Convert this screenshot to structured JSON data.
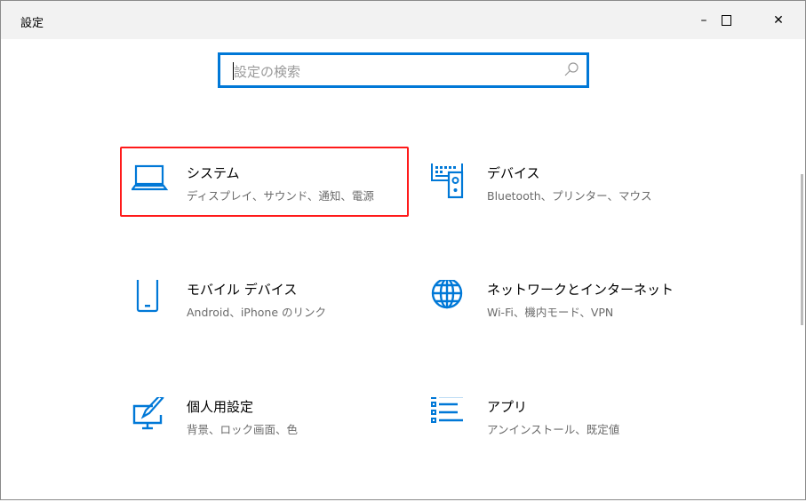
{
  "window": {
    "title": "設定",
    "minimize": "–",
    "maximize": "☐",
    "close": "✕"
  },
  "search": {
    "placeholder": "設定の検索"
  },
  "colors": {
    "accent": "#0078d7",
    "highlight": "#ff1a1a"
  },
  "tiles": [
    {
      "title": "システム",
      "subtitle": "ディスプレイ、サウンド、通知、電源",
      "icon": "laptop-icon"
    },
    {
      "title": "デバイス",
      "subtitle": "Bluetooth、プリンター、マウス",
      "icon": "keyboard-speaker-icon"
    },
    {
      "title": "モバイル デバイス",
      "subtitle": "Android、iPhone のリンク",
      "icon": "phone-icon"
    },
    {
      "title": "ネットワークとインターネット",
      "subtitle": "Wi-Fi、機内モード、VPN",
      "icon": "globe-icon"
    },
    {
      "title": "個人用設定",
      "subtitle": "背景、ロック画面、色",
      "icon": "personalization-icon"
    },
    {
      "title": "アプリ",
      "subtitle": "アンインストール、既定値",
      "icon": "apps-list-icon"
    }
  ]
}
